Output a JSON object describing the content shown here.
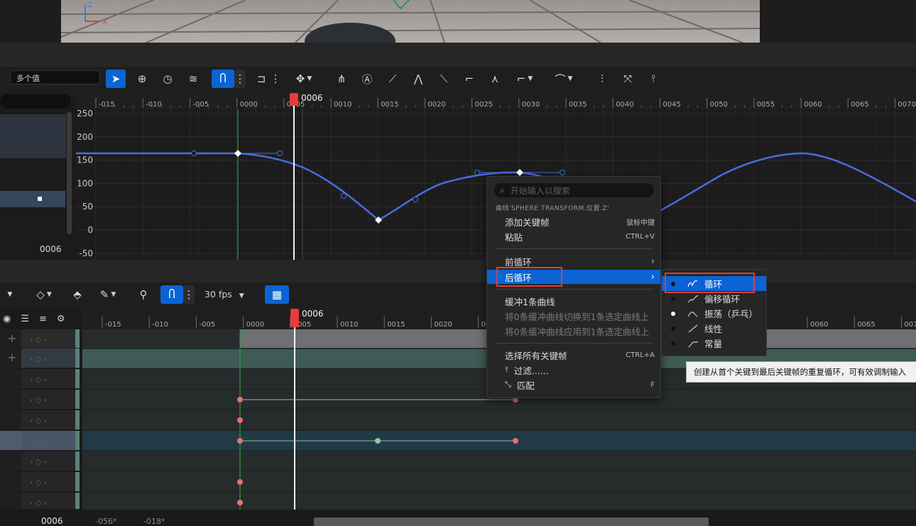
{
  "toolbar": {
    "value_field": "多个值",
    "fps": "30 fps"
  },
  "timeline": {
    "playhead_frame": "0006",
    "ruler_labels": [
      "-015",
      "-010",
      "-005",
      "0000",
      "0005",
      "0010",
      "0015",
      "0020",
      "0025",
      "0030",
      "0035",
      "0040",
      "0045",
      "0050",
      "0055",
      "0060",
      "0065",
      "0070"
    ],
    "ruler2_labels": [
      "-015",
      "-010",
      "-005",
      "0000",
      "0005",
      "0010",
      "0015",
      "0020",
      "002",
      "0060",
      "0065",
      "0070"
    ]
  },
  "graph": {
    "y_labels": [
      "250",
      "200",
      "150",
      "100",
      "50",
      "0",
      "-50"
    ],
    "left_frame": "0006"
  },
  "context_menu": {
    "search_placeholder": "开始输入以搜索",
    "curve_label": "曲线'SPHERE.TRANSFORM.位置.Z'",
    "add_key": "添加关键帧",
    "add_key_shortcut": "鼠标中键",
    "paste": "粘贴",
    "paste_shortcut": "CTRL+V",
    "pre_infinity": "前循环",
    "post_infinity": "后循环",
    "buffer_curve": "缓冲1条曲线",
    "swap_buffer": "将0条缓冲曲线切换到1条选定曲线上",
    "apply_buffer": "将0条缓冲曲线应用到1条选定曲线上",
    "select_all_keys": "选择所有关键帧",
    "select_all_shortcut": "CTRL+A",
    "filter": "过滤......",
    "fit": "匹配",
    "fit_shortcut": "F"
  },
  "submenu": {
    "items": [
      "循环",
      "偏移循环",
      "振荡（乒乓）",
      "线性",
      "常量"
    ]
  },
  "tooltip": "创建从首个关键到最后关键帧的重复循环，可有效调制输入",
  "bottom": {
    "frame": "0006",
    "start": "-056*",
    "end": "-018*"
  },
  "colors": {
    "accent": "#0a64d4",
    "curve": "#4a6be0",
    "playhead": "#e63c3c",
    "key_red": "#e5736b",
    "key_green": "#8fc79a"
  }
}
